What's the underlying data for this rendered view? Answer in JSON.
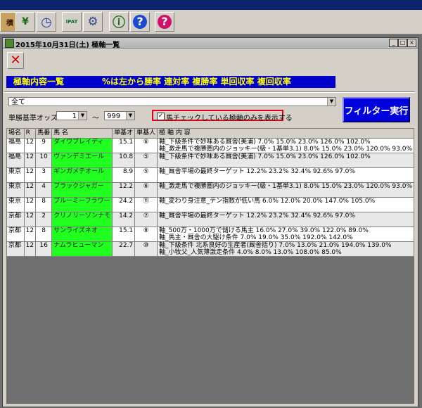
{
  "toolbar": {
    "buttons": [
      {
        "name": "book-icon",
        "glyph": "積"
      },
      {
        "name": "money-icon",
        "glyph": "¥"
      },
      {
        "name": "clock-icon",
        "glyph": "◷"
      },
      {
        "name": "ipat-icon",
        "glyph": "IPAT"
      },
      {
        "name": "gear-icon",
        "glyph": "⚙"
      },
      {
        "name": "info-icon",
        "glyph": "ⓘ"
      },
      {
        "name": "help-icon",
        "glyph": "?"
      },
      {
        "name": "question-icon",
        "glyph": "?"
      }
    ]
  },
  "window": {
    "title": "2015年10月31日(土)  極軸一覧",
    "min_label": "_",
    "max_label": "□",
    "close_label": "×"
  },
  "banner": {
    "left": "極軸内容一覧",
    "right": "%は左から勝率 連対率 複勝率 単回収率 複回収率"
  },
  "filters": {
    "venue_select": "全て",
    "odds_label": "単勝基準オッズ",
    "odds_min": "1",
    "tilde": "～",
    "odds_max": "999",
    "check_mark": "✓",
    "check_label": "馬チェックしている極軸のみを表示する",
    "run_button": "フィルター実行"
  },
  "table": {
    "headers": [
      "場名",
      "R",
      "馬番",
      "馬 名",
      "単基オ",
      "単基人",
      "極 軸 内 容"
    ],
    "rows": [
      {
        "venue": "福島",
        "race": "12",
        "num": "9",
        "horse": "ダイワブレイディ",
        "odds": "15.1",
        "pop": "⑥",
        "lines": [
          "軸_下級条件で妙味ある厩舎(美浦) 7.0% 15.0% 23.0% 126.0% 102.0%",
          "軸_激走馬で複勝圏内のジョッキー(級・1基単3.1) 8.0% 15.0% 23.0% 120.0% 93.0%"
        ]
      },
      {
        "venue": "福島",
        "race": "12",
        "num": "10",
        "horse": "ヴァンデミエール",
        "odds": "10.8",
        "pop": "⑤",
        "lines": [
          "軸_下級条件で妙味ある厩舎(美浦) 7.0% 15.0% 23.0% 126.0% 102.0%"
        ]
      },
      {
        "venue": "東京",
        "race": "12",
        "num": "3",
        "horse": "ギンガメテオール",
        "odds": "8.9",
        "pop": "⑤",
        "lines": [
          "軸_厩舎平場の最終ターゲット 12.2% 23.2% 32.4% 92.6% 97.0%"
        ]
      },
      {
        "venue": "東京",
        "race": "12",
        "num": "4",
        "horse": "ブラックジャガー",
        "odds": "12.2",
        "pop": "⑥",
        "lines": [
          "軸_激走馬で複勝圏内のジョッキー(級・1基単3.1) 8.0% 15.0% 23.0% 120.0% 93.0%"
        ]
      },
      {
        "venue": "東京",
        "race": "12",
        "num": "8",
        "horse": "ブルーミーフラワー",
        "odds": "24.2",
        "pop": "⑪",
        "lines": [
          "軸_変わり身注意_テン指数が低い馬 6.0% 12.0% 20.0% 147.0% 105.0%"
        ]
      },
      {
        "venue": "京都",
        "race": "12",
        "num": "2",
        "horse": "クリノリーゾンナモ",
        "odds": "14.2",
        "pop": "⑦",
        "lines": [
          "軸_厩舎平場の最終ターゲット 12.2% 23.2% 32.4% 92.6% 97.0%"
        ]
      },
      {
        "venue": "京都",
        "race": "12",
        "num": "8",
        "horse": "サンライズネオ",
        "odds": "15.1",
        "pop": "⑧",
        "lines": [
          "軸_500万・1000万で儲ける馬主 16.0% 27.0% 39.0% 122.0% 89.0%",
          "軸_馬主・厩舎の大駆け条件 7.0% 19.0% 35.0% 192.0% 142.0%"
        ]
      },
      {
        "venue": "京都",
        "race": "12",
        "num": "16",
        "horse": "ナムラヒューマン",
        "odds": "22.7",
        "pop": "⑩",
        "lines": [
          "軸_下級条件 北系良好の生産者(厩舎括り) 7.0% 13.0% 21.0% 194.0% 139.0%",
          "軸_小牧父_人気薄激走条件 4.0% 8.0% 13.0% 108.0% 85.0%"
        ]
      }
    ]
  }
}
